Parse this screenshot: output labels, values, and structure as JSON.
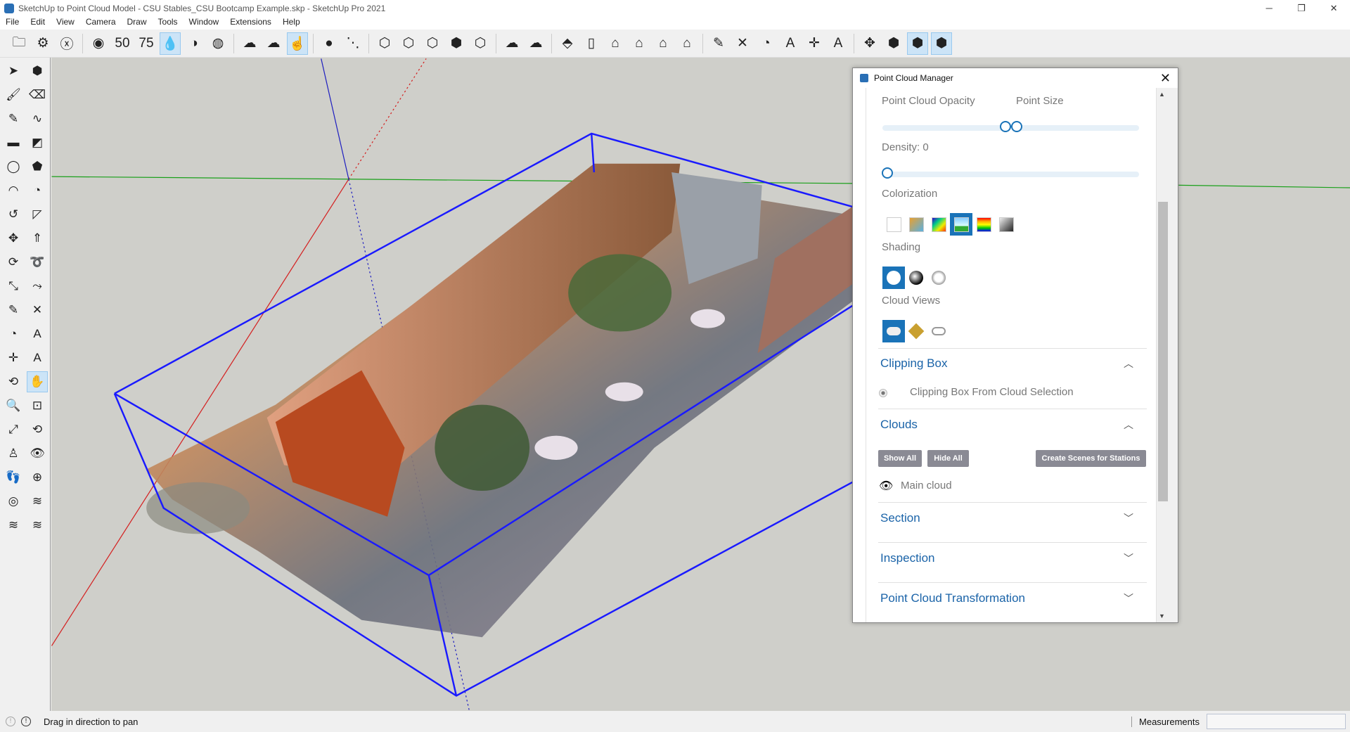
{
  "window": {
    "title": "SketchUp to Point Cloud Model - CSU Stables_CSU Bootcamp Example.skp - SketchUp Pro 2021",
    "minimize": "─",
    "restore": "❐",
    "close": "✕"
  },
  "menu": [
    "File",
    "Edit",
    "View",
    "Camera",
    "Draw",
    "Tools",
    "Window",
    "Extensions",
    "Help"
  ],
  "toolbar": [
    [
      "open-folder",
      "🗀"
    ],
    [
      "settings-gear",
      "⚙"
    ],
    [
      "cancel-circle",
      "ⓧ"
    ],
    [
      "|",
      ""
    ],
    [
      "point-cloud-view",
      "◉"
    ],
    [
      "opacity-50",
      "50"
    ],
    [
      "opacity-75",
      "75"
    ],
    [
      "drop-outline",
      "💧"
    ],
    [
      "drop-half",
      "◑"
    ],
    [
      "drop-hatched",
      "◍"
    ],
    [
      "|",
      ""
    ],
    [
      "cloud-remove",
      "☁"
    ],
    [
      "cloud-upload",
      "☁"
    ],
    [
      "point-cloud-select",
      "☝"
    ],
    [
      "|",
      ""
    ],
    [
      "add-point",
      "●"
    ],
    [
      "measure-line",
      "⋱"
    ],
    [
      "|",
      ""
    ],
    [
      "hex-history",
      "⬡"
    ],
    [
      "hex-block",
      "⬡"
    ],
    [
      "hex-cloud",
      "⬡"
    ],
    [
      "hex-logo",
      "⬢"
    ],
    [
      "hex-select",
      "⬡"
    ],
    [
      "|",
      ""
    ],
    [
      "cloud-sync",
      "☁"
    ],
    [
      "cloud-refresh",
      "☁"
    ],
    [
      "|",
      ""
    ],
    [
      "iso-view",
      "⬘"
    ],
    [
      "front-view",
      "▯"
    ],
    [
      "home-view",
      "⌂"
    ],
    [
      "top-view",
      "⌂"
    ],
    [
      "house-outline",
      "⌂"
    ],
    [
      "back-view",
      "⌂"
    ],
    [
      "|",
      ""
    ],
    [
      "tape-measure",
      "✎"
    ],
    [
      "dimension",
      "✕"
    ],
    [
      "protractor",
      "◔"
    ],
    [
      "text-label",
      "A"
    ],
    [
      "axes",
      "✛"
    ],
    [
      "3d-text",
      "A"
    ],
    [
      "|",
      ""
    ],
    [
      "orbit-target",
      "✥"
    ],
    [
      "pc-cube-1",
      "⬢"
    ],
    [
      "pc-cube-2",
      "⬢"
    ],
    [
      "pc-cube-3",
      "⬢"
    ]
  ],
  "toolbar_active": [
    7,
    13,
    43,
    44
  ],
  "left_tools": [
    [
      "select",
      "➤"
    ],
    [
      "component",
      "⬢"
    ],
    [
      "paint-bucket",
      "🖌"
    ],
    [
      "eraser",
      "⌫"
    ],
    [
      "pencil",
      "✎"
    ],
    [
      "freehand",
      "∿"
    ],
    [
      "rectangle",
      "▬"
    ],
    [
      "rotated-rectangle",
      "◩"
    ],
    [
      "circle",
      "◯"
    ],
    [
      "polygon",
      "⬟"
    ],
    [
      "arc",
      "◠"
    ],
    [
      "pie",
      "◔"
    ],
    [
      "arc-3pt",
      "↺"
    ],
    [
      "arc-2pt",
      "◸"
    ],
    [
      "move",
      "✥"
    ],
    [
      "push-pull",
      "⇑"
    ],
    [
      "rotate",
      "⟳"
    ],
    [
      "follow-me",
      "➰"
    ],
    [
      "scale",
      "⤡"
    ],
    [
      "offset",
      "⤳"
    ],
    [
      "tape-measure",
      "✎"
    ],
    [
      "dimension",
      "✕"
    ],
    [
      "protractor",
      "◔"
    ],
    [
      "text",
      "A"
    ],
    [
      "axes",
      "✛"
    ],
    [
      "3d-text",
      "A"
    ],
    [
      "orbit",
      "⟲"
    ],
    [
      "pan",
      "✋"
    ],
    [
      "zoom",
      "🔍"
    ],
    [
      "zoom-window",
      "⊡"
    ],
    [
      "zoom-extents",
      "⤢"
    ],
    [
      "previous",
      "⟲"
    ],
    [
      "position-camera",
      "♙"
    ],
    [
      "look-around",
      "👁"
    ],
    [
      "walk",
      "👣"
    ],
    [
      "section-plane",
      "⊕"
    ],
    [
      "sandbox-1",
      "◎"
    ],
    [
      "sandbox-2",
      "≋"
    ],
    [
      "sandbox-3",
      "≋"
    ],
    [
      "sandbox-4",
      "≋"
    ]
  ],
  "left_active": [
    27
  ],
  "status": {
    "message": "Drag in direction to pan",
    "measurements_label": "Measurements",
    "measurements_value": ""
  },
  "panel": {
    "title": "Point Cloud Manager",
    "close": "✕",
    "opacity_label": "Point Cloud Opacity",
    "opacity_value": 1.0,
    "point_size_label": "Point Size",
    "point_size_value": 0,
    "density_label": "Density: 0",
    "density_value": 0,
    "colorization_label": "Colorization",
    "colorization": [
      "none",
      "intensity-cone",
      "rainbow-diagonal",
      "elevation-sky",
      "spectrum-bands",
      "grayscale"
    ],
    "colorization_selected": 3,
    "shading_label": "Shading",
    "shading": [
      "flat",
      "sphere-dark",
      "sphere-light"
    ],
    "shading_selected": 0,
    "cloud_views_label": "Cloud Views",
    "cloud_views": [
      "cloud",
      "cube-gold",
      "cloud-outline"
    ],
    "cloud_views_selected": 0,
    "clipping": {
      "title": "Clipping Box",
      "option": "Clipping Box From Cloud Selection",
      "expanded": true
    },
    "clouds": {
      "title": "Clouds",
      "show_all": "Show All",
      "hide_all": "Hide All",
      "create_scenes": "Create Scenes for Stations",
      "items": [
        "Main cloud"
      ],
      "expanded": true
    },
    "section": {
      "title": "Section"
    },
    "inspection": {
      "title": "Inspection"
    },
    "transformation": {
      "title": "Point Cloud Transformation"
    },
    "chevron_up": "︿",
    "chevron_down": "﹀"
  },
  "colors": {
    "accent": "#1a73b8",
    "box": "#1a1aff",
    "x_axis": "#d42020",
    "y_axis": "#1aa01a",
    "z_axis": "#2020c0"
  }
}
